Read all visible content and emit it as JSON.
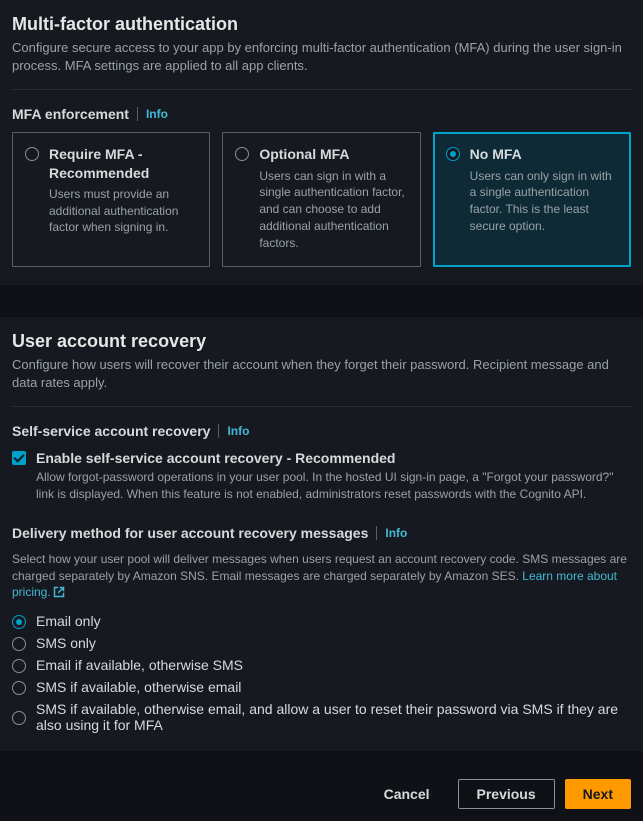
{
  "mfa": {
    "title": "Multi-factor authentication",
    "desc": "Configure secure access to your app by enforcing multi-factor authentication (MFA) during the user sign-in process. MFA settings are applied to all app clients.",
    "enforcement_label": "MFA enforcement",
    "info": "Info",
    "options": [
      {
        "title": "Require MFA - Recommended",
        "desc": "Users must provide an additional authentication factor when signing in."
      },
      {
        "title": "Optional MFA",
        "desc": "Users can sign in with a single authentication factor, and can choose to add additional authentication factors."
      },
      {
        "title": "No MFA",
        "desc": "Users can only sign in with a single authentication factor. This is the least secure option."
      }
    ],
    "selected": 2
  },
  "recovery": {
    "title": "User account recovery",
    "desc": "Configure how users will recover their account when they forget their password. Recipient message and data rates apply.",
    "self_service_label": "Self-service account recovery",
    "info": "Info",
    "checkbox_label": "Enable self-service account recovery - Recommended",
    "checkbox_desc": "Allow forgot-password operations in your user pool. In the hosted UI sign-in page, a \"Forgot your password?\" link is displayed. When this feature is not enabled, administrators reset passwords with the Cognito API.",
    "checkbox_checked": true,
    "delivery_label": "Delivery method for user account recovery messages",
    "delivery_desc_before": "Select how your user pool will deliver messages when users request an account recovery code. SMS messages are charged separately by Amazon SNS. Email messages are charged separately by Amazon SES. ",
    "delivery_link": "Learn more about pricing.",
    "delivery_options": [
      "Email only",
      "SMS only",
      "Email if available, otherwise SMS",
      "SMS if available, otherwise email",
      "SMS if available, otherwise email, and allow a user to reset their password via SMS if they are also using it for MFA"
    ],
    "delivery_selected": 0
  },
  "footer": {
    "cancel": "Cancel",
    "previous": "Previous",
    "next": "Next"
  }
}
